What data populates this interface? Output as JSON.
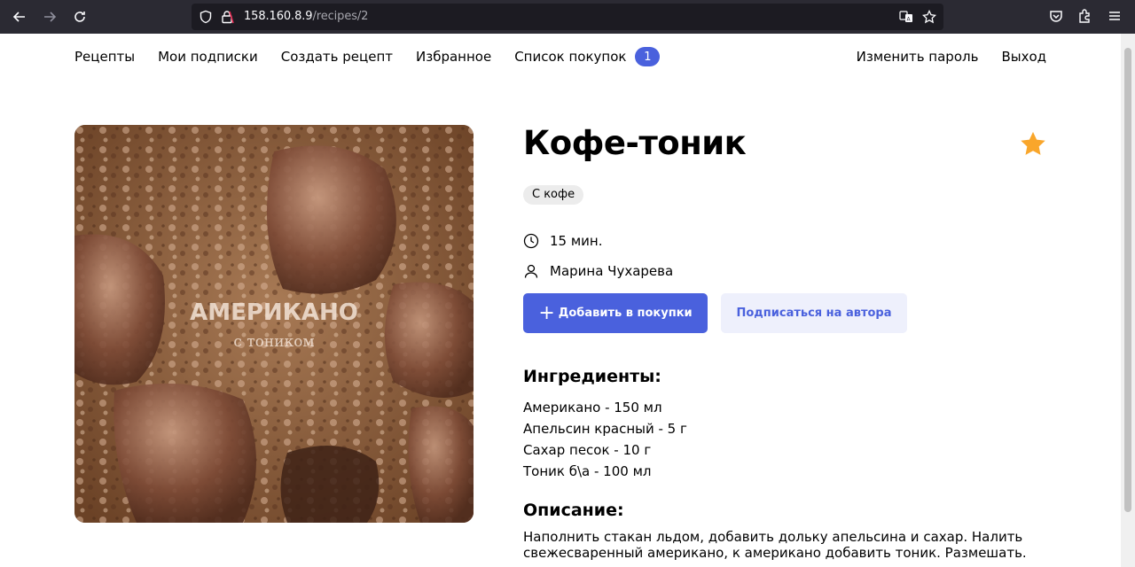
{
  "browser": {
    "url_host": "158.160.8.9",
    "url_path": "/recipes/2",
    "icons": [
      "back-icon",
      "forward-icon",
      "reload-icon",
      "shield-icon",
      "lock-icon",
      "translate-icon",
      "bookmark-star-icon",
      "pocket-icon",
      "extensions-icon",
      "menu-icon"
    ]
  },
  "nav": {
    "recipes": "Рецепты",
    "subscriptions": "Мои подписки",
    "create": "Создать рецепт",
    "favorites": "Избранное",
    "shopping_list": "Список покупок",
    "shopping_count": "1",
    "change_password": "Изменить пароль",
    "logout": "Выход"
  },
  "recipe": {
    "image_text_main": "АМЕРИКАНО",
    "image_text_sub": "с тоником",
    "title": "Кофе-тоник",
    "tag": "С кофе",
    "tag_color": "#ececec",
    "time": "15 мин.",
    "author": "Марина Чухарева",
    "favorite_color": "#f9a62b",
    "add_to_cart": "Добавить в покупки",
    "subscribe": "Подписаться на автора",
    "ingredients_title": "Ингредиенты:",
    "ingredients": [
      "Американо - 150 мл",
      "Апельсин красный - 5 г",
      "Сахар песок - 10 г",
      "Тоник б\\а - 100 мл"
    ],
    "description_title": "Описание:",
    "description": "Наполнить стакан льдом, добавить дольку апельсина и сахар. Налить свежесваренный американо, к американо добавить тоник. Размешать."
  },
  "colors": {
    "accent": "#4a61dd",
    "accent_light": "#eef0fc",
    "chrome_bg": "#2b2a33"
  }
}
